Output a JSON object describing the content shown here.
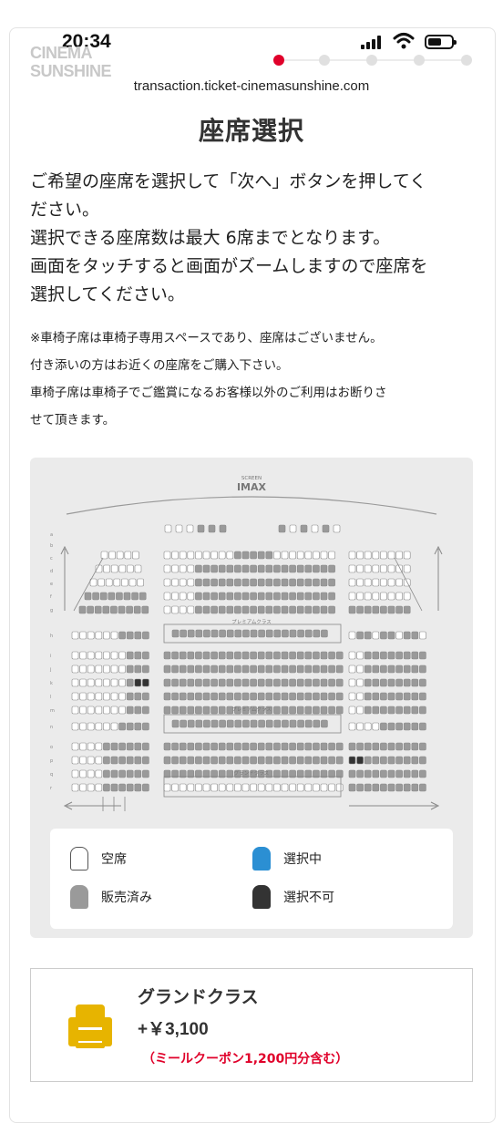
{
  "status": {
    "time": "20:34"
  },
  "header": {
    "logo_line1": "CINEMA",
    "logo_line2": "SUNSHINE",
    "url": "transaction.ticket-cinemasunshine.com"
  },
  "progress": {
    "total_steps": 5,
    "current_step": 1,
    "active_color": "#e0002a"
  },
  "page": {
    "title": "座席選択",
    "desc": [
      "ご希望の座席を選択して「次へ」ボタンを押してく",
      "ださい。",
      "選択できる座席数は最大 6席までとなります。",
      "画面をタッチすると画面がズームしますので座席を",
      "選択してください。"
    ],
    "notes": [
      "※車椅子席は車椅子専用スペースであり、座席はございません。",
      "付き添いの方はお近くの座席をご購入下さい。",
      "車椅子席は車椅子でご鑑賞になるお客様以外のご利用はお断りさ",
      "せて頂きます。"
    ]
  },
  "seatmap": {
    "screen_small": "SCREEN",
    "screen_label": "IMAX",
    "rows": [
      "a",
      "b",
      "c",
      "d",
      "e",
      "f",
      "g",
      "h",
      "i",
      "j",
      "k",
      "l",
      "m",
      "n",
      "o",
      "p",
      "q",
      "r"
    ],
    "section_labels": [
      "プレミアムクラス",
      "プレミアムクラス",
      "グランドクラス"
    ]
  },
  "legend": {
    "empty": "空席",
    "selected": "選択中",
    "sold": "販売済み",
    "unavailable": "選択不可",
    "colors": {
      "empty": "#ffffff",
      "selected": "#2b8fd3",
      "sold": "#9a9a9a",
      "unavailable": "#333333"
    }
  },
  "ticket": {
    "class_name": "グランドクラス",
    "price": "+￥3,100",
    "coupon_note": "（ミールクーポン1,200円分含む）",
    "icon": "armchair-icon",
    "icon_color": "#e7b400"
  }
}
